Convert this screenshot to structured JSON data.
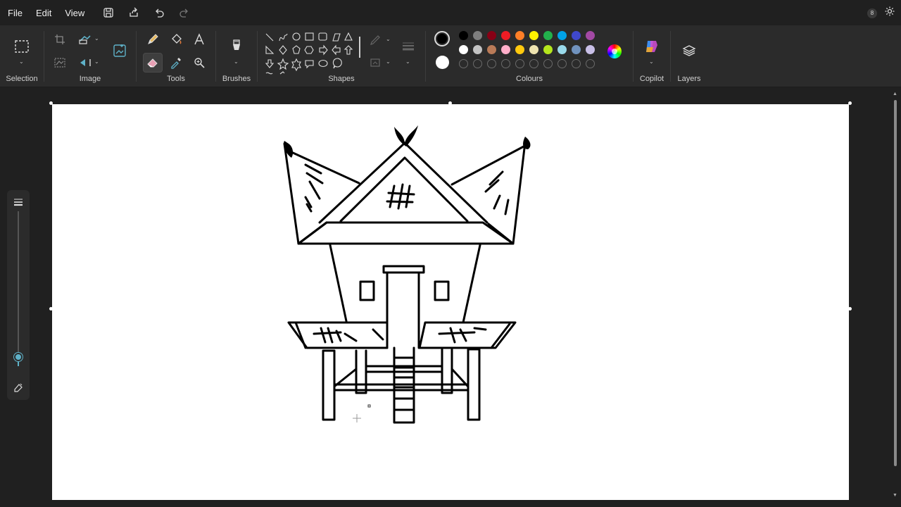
{
  "menu": {
    "file": "File",
    "edit": "Edit",
    "view": "View"
  },
  "ribbon": {
    "groups": {
      "selection": "Selection",
      "image": "Image",
      "tools": "Tools",
      "brushes": "Brushes",
      "shapes": "Shapes",
      "colours": "Colours",
      "copilot": "Copilot",
      "layers": "Layers"
    },
    "active_tool": "eraser"
  },
  "colours": {
    "primary": "#000000",
    "secondary": "#ffffff",
    "palette_row1": [
      "#000000",
      "#7f7f7f",
      "#880015",
      "#ed1c24",
      "#ff7f27",
      "#fff200",
      "#22b14c",
      "#00a2e8",
      "#3f48cc",
      "#a349a4"
    ],
    "palette_row2": [
      "#ffffff",
      "#c3c3c3",
      "#b97a57",
      "#ffaec9",
      "#ffc90e",
      "#efe4b0",
      "#b5e61d",
      "#99d9ea",
      "#7092be",
      "#c8bfe7"
    ],
    "custom_slots": 10
  },
  "zoom": {
    "level": 0.06
  }
}
